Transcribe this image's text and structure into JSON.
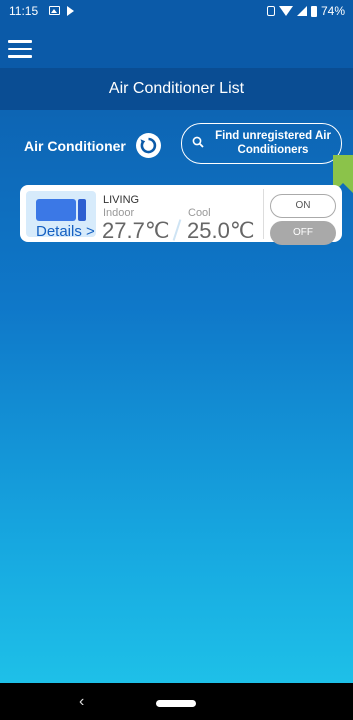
{
  "status_bar": {
    "time": "11:15",
    "battery": "74%"
  },
  "header": {
    "title": "Air Conditioner List"
  },
  "section": {
    "label": "Air Conditioner",
    "find_button_label": "Find unregistered Air Conditioners"
  },
  "units": [
    {
      "name": "LIVING",
      "indoor_label": "Indoor",
      "indoor_temp": "27.7℃",
      "mode": "Cool",
      "set_temp": "25.0℃",
      "details_label": "Details >",
      "on_label": "ON",
      "off_label": "OFF"
    }
  ],
  "colors": {
    "header": "#0b5aa8",
    "title_bar": "#0a4d93",
    "accent": "#8bc34a"
  }
}
